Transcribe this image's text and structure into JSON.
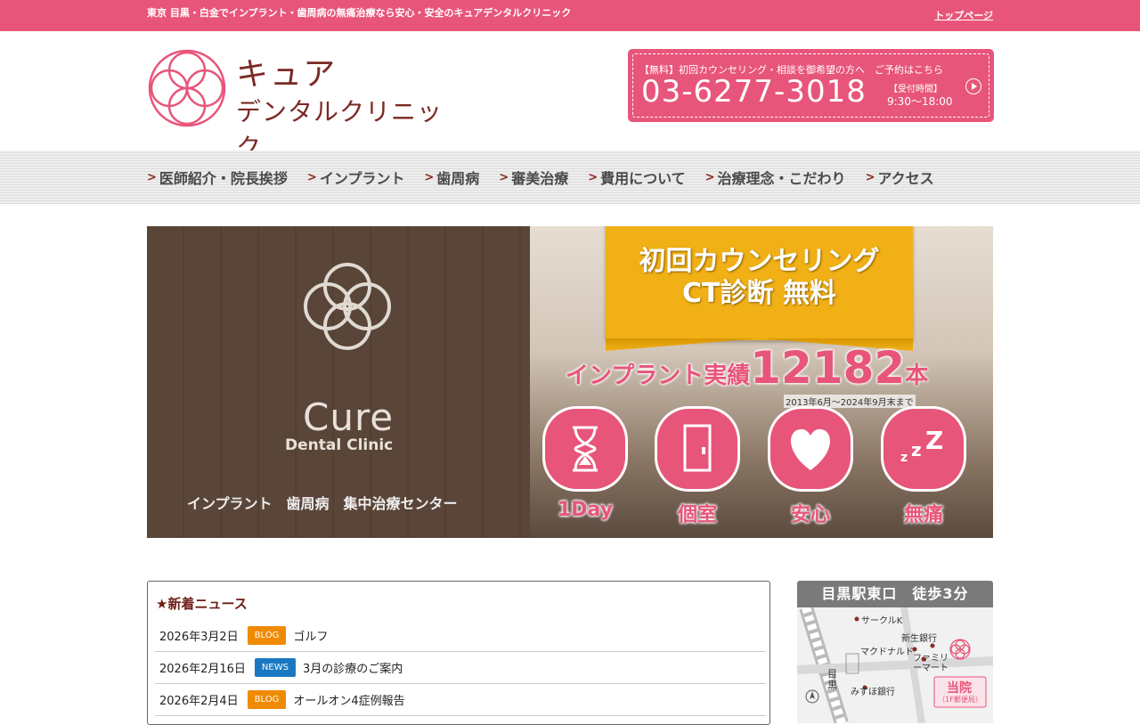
{
  "topbar": {
    "tagline": "東京 目黒・白金でインプラント・歯周病の無痛治療なら安心・安全のキュアデンタルクリニック",
    "top_link": "トップページ"
  },
  "header": {
    "logo_name_line1": "キュア",
    "logo_name_line2": "デンタルクリニック",
    "contact_line": "【無料】初回カウンセリング・相談を御希望の方へ　ご予約はこちら",
    "phone": "03-6277-3018",
    "hours_label": "【受付時間】",
    "hours": "9:30〜18:00"
  },
  "nav": {
    "items": [
      {
        "label": "医師紹介・院長挨拶"
      },
      {
        "label": "インプラント"
      },
      {
        "label": "歯周病"
      },
      {
        "label": "審美治療"
      },
      {
        "label": "費用について"
      },
      {
        "label": "治療理念・こだわり"
      },
      {
        "label": "アクセス"
      }
    ]
  },
  "hero": {
    "sign_cure": "Cure",
    "sign_dental": "Dental Clinic",
    "sign_row": "インプラント　歯周病　集中治療センター",
    "ribbon_line1": "初回カウンセリング",
    "ribbon_line2": "CT診断 無料",
    "record_label": "インプラント実績",
    "record_number": "12182",
    "record_unit": "本",
    "record_period": "2013年6月〜2024年9月末まで",
    "features": [
      {
        "label": "1Day",
        "icon": "hourglass-icon"
      },
      {
        "label": "個室",
        "icon": "door-icon"
      },
      {
        "label": "安心",
        "icon": "heart-icon"
      },
      {
        "label": "無痛",
        "icon": "sleep-zzz-icon"
      }
    ]
  },
  "news": {
    "title": "★新着ニュース",
    "items": [
      {
        "date": "2026年3月2日",
        "badge": "BLOG",
        "badge_color": "#f08a00",
        "text": "ゴルフ"
      },
      {
        "date": "2026年2月16日",
        "badge": "NEWS",
        "badge_color": "#1a78c2",
        "text": "3月の診療のご案内"
      },
      {
        "date": "2026年2月4日",
        "badge": "BLOG",
        "badge_color": "#f08a00",
        "text": "オールオン4症例報告"
      }
    ]
  },
  "access": {
    "title": "目黒駅東口　徒歩3分",
    "map_labels": {
      "circle_k": "サークルK",
      "shinsei": "新生銀行",
      "mcd": "マクドナルド",
      "family": "ファミリーマート",
      "mizuho": "みずほ銀行",
      "station": "目黒",
      "clinic": "当院",
      "clinic_sub": "（1F郵便局）"
    }
  },
  "colors": {
    "brand_pink": "#e8557a",
    "logo_brown": "#7a2a25",
    "ribbon_gold": "#f0b016"
  }
}
